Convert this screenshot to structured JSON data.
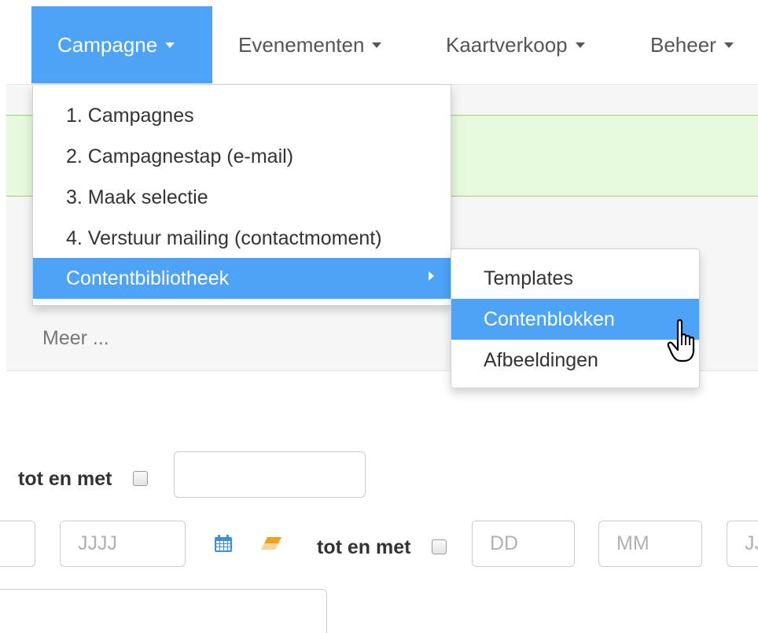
{
  "nav": {
    "items": [
      {
        "label": "Campagne",
        "active": true
      },
      {
        "label": "Evenementen",
        "active": false
      },
      {
        "label": "Kaartverkoop",
        "active": false
      },
      {
        "label": "Beheer",
        "active": false
      }
    ]
  },
  "dropdown": {
    "items": [
      {
        "label": "1. Campagnes"
      },
      {
        "label": "2. Campagnestap (e-mail)"
      },
      {
        "label": "3. Maak selectie"
      },
      {
        "label": "4. Verstuur mailing (contactmoment)"
      },
      {
        "label": "Contentbibliotheek",
        "active": true,
        "has_submenu": true
      }
    ]
  },
  "submenu": {
    "items": [
      {
        "label": "Templates"
      },
      {
        "label": "Contenblokken",
        "active": true
      },
      {
        "label": "Afbeeldingen"
      }
    ]
  },
  "page": {
    "meer_label": "Meer ..."
  },
  "form": {
    "tot_en_met_label": "tot en met",
    "year_placeholder": "JJJJ",
    "day_placeholder": "DD",
    "month_placeholder": "MM",
    "year_cut_placeholder": "JJJJ"
  },
  "icons": {
    "calendar": "calendar-icon",
    "eraser": "eraser-icon",
    "cursor": "hand-pointer-icon"
  },
  "colors": {
    "accent": "#4da3f7",
    "alert_bg": "#e6f9dc",
    "alert_border": "#9ad277",
    "eraser": "#f0a020",
    "calendar": "#3a8fe0"
  }
}
